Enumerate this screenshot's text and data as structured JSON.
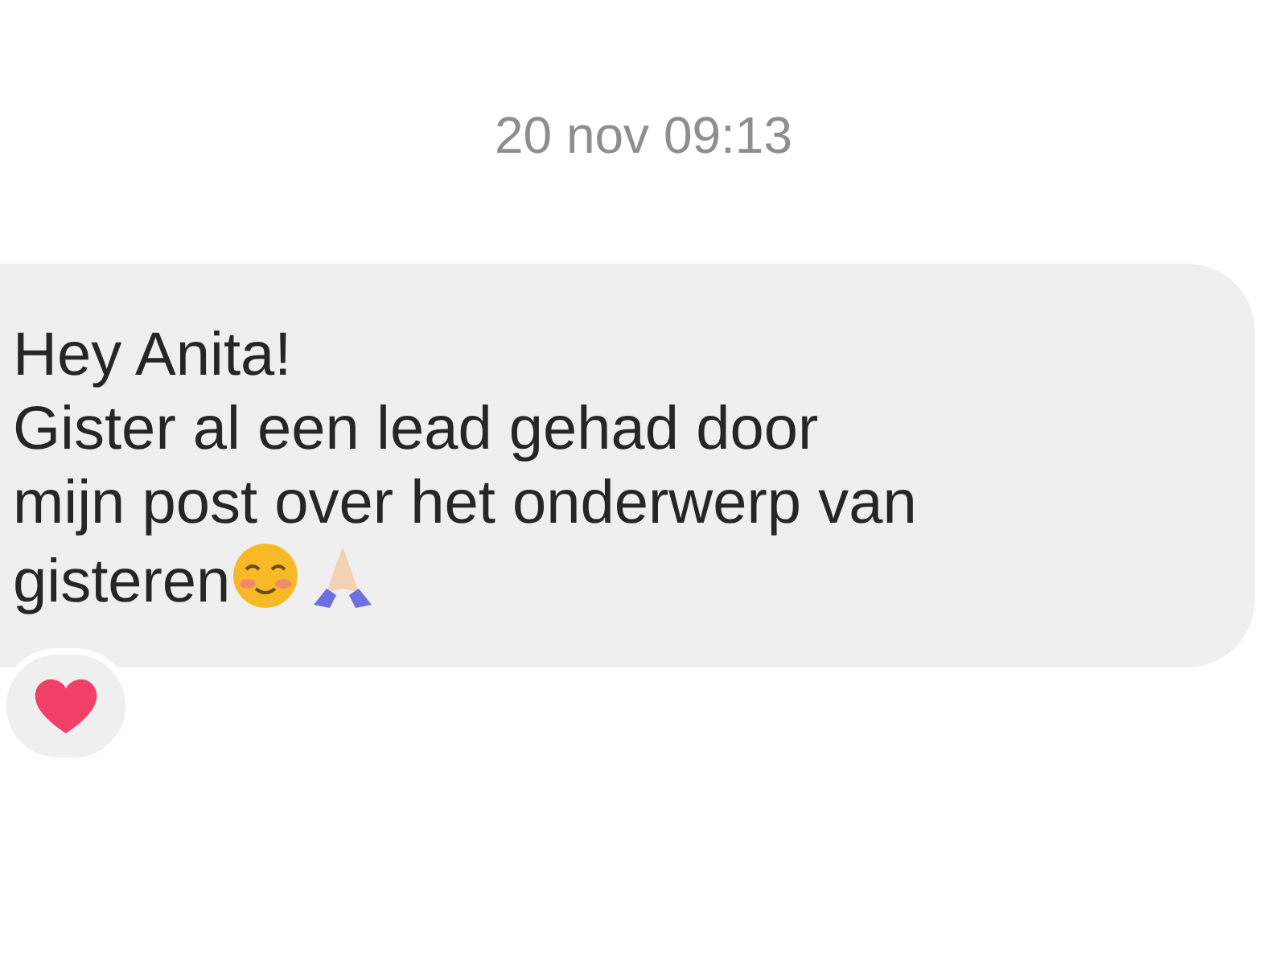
{
  "timestamp": "20 nov 09:13",
  "message": {
    "lines": [
      "Hey Anita!",
      "Gister al een lead gehad door",
      "mijn post over het onderwerp van",
      "gisteren"
    ]
  }
}
